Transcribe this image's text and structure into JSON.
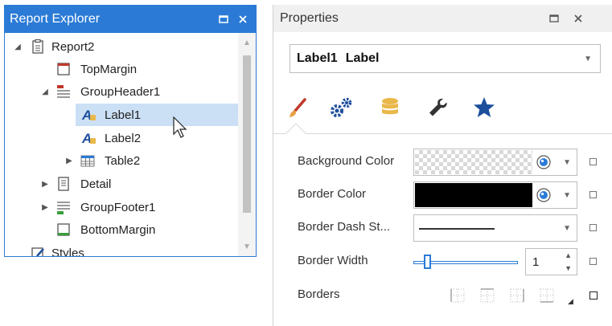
{
  "report_explorer": {
    "title": "Report Explorer",
    "items": [
      {
        "label": "Report2",
        "icon": "report-icon"
      },
      {
        "label": "TopMargin",
        "icon": "margin-band-icon"
      },
      {
        "label": "GroupHeader1",
        "icon": "group-header-icon"
      },
      {
        "label": "Label1",
        "icon": "label-icon"
      },
      {
        "label": "Label2",
        "icon": "label-icon"
      },
      {
        "label": "Table2",
        "icon": "table-icon"
      },
      {
        "label": "Detail",
        "icon": "detail-band-icon"
      },
      {
        "label": "GroupFooter1",
        "icon": "group-footer-icon"
      },
      {
        "label": "BottomMargin",
        "icon": "margin-band-icon"
      },
      {
        "label": "Styles",
        "icon": "styles-icon"
      }
    ],
    "selected": "Label1"
  },
  "properties": {
    "title": "Properties",
    "selector_name": "Label1",
    "selector_type": "Label",
    "tabs": [
      "brush-icon",
      "gears-icon",
      "database-icon",
      "wrench-icon",
      "star-icon"
    ],
    "rows": {
      "background_color": "Background Color",
      "border_color": "Border Color",
      "border_dash_style": "Border Dash St...",
      "border_width": "Border Width",
      "borders": "Borders"
    },
    "border_width_value": "1",
    "border_width_level": 0.1,
    "colors": {
      "accent": "#2b7bd6",
      "selection": "#cce0f5",
      "border_color_value": "#000000",
      "brush_orange": "#e8a24a",
      "icon_blue": "#1d4f9c",
      "db_yellow": "#e9b84a"
    }
  }
}
